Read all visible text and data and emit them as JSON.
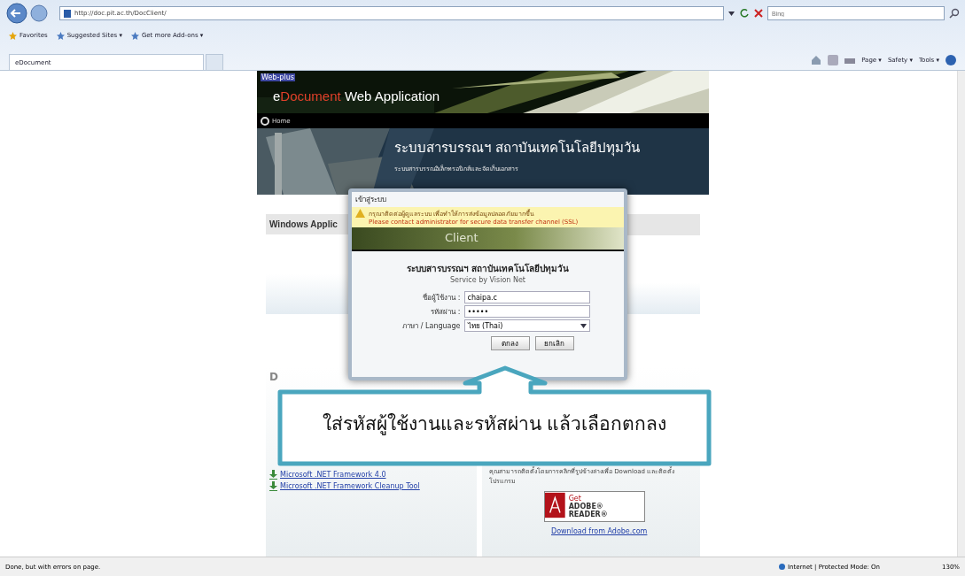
{
  "browser": {
    "address": "http://doc.pit.ac.th/DocClient/",
    "search": {
      "placeholder": "Bing"
    },
    "favorites_bar": [
      "Favorites",
      "Suggested Sites ▾",
      "Get more Add-ons ▾"
    ],
    "tabs": [
      {
        "label": "eDocument",
        "selected": true
      }
    ],
    "command_bar": [
      "Page ▾",
      "Safety ▾",
      "Tools ▾"
    ]
  },
  "header": {
    "logo": "Web-plus",
    "title_parts": [
      {
        "text": "e",
        "accent": false
      },
      {
        "text": "Document",
        "accent": true
      },
      {
        "text": "Web Application",
        "accent": false
      }
    ],
    "nav": [
      "Home"
    ],
    "hero_title": "ระบบสารบรรณฯ สถาบันเทคโนโลยีปทุมวัน",
    "hero_subtitle": "ระบบสารบรรณอิเล็กทรอนิกส์และจัดเก็บเอกสาร"
  },
  "panels": [
    {
      "heading": "Windows Applic"
    }
  ],
  "downloads": {
    "heading": "D",
    "links": [
      "Microsoft .NET Framework 4.0",
      "Microsoft .NET Framework Cleanup Tool"
    ]
  },
  "adobe": {
    "text": "คุณสามารถติดตั้งโดยการคลิกที่รูปข้างล่างเพื่อ Download และติดตั้งโปรแกรม",
    "badge_small": "Get",
    "badge": "ADOBE® READER®",
    "link": "Download from Adobe.com"
  },
  "dialog": {
    "title": "เข้าสู่ระบบ",
    "warning": [
      "กรุณาติดต่อผู้ดูแลระบบ เพื่อทำให้การส่งข้อมูลปลอดภัยมากขึ้น",
      "Please contact administrator for secure data transfer channel (SSL)"
    ],
    "banner_text": "Client",
    "heading": "ระบบสารบรรณฯ สถาบันเทคโนโลยีปทุมวัน",
    "service": "Service by Vision Net",
    "fields": [
      {
        "kind": "text",
        "label": "ชื่อผู้ใช้งาน :",
        "value": "chaipa.c"
      },
      {
        "kind": "password",
        "label": "รหัสผ่าน :",
        "value": "•••••"
      },
      {
        "kind": "select",
        "label": "ภาษา / Language",
        "value": "ไทย (Thai)"
      }
    ],
    "buttons": [
      "ตกลง",
      "ยกเลิก"
    ]
  },
  "callout": {
    "text": "ใส่รหัสผู้ใช้งานและรหัสผ่าน แล้วเลือกตกลง"
  },
  "status_bar": {
    "message": "Done, but with errors on page.",
    "zone": "Internet | Protected Mode: On",
    "zoom": "130%"
  }
}
